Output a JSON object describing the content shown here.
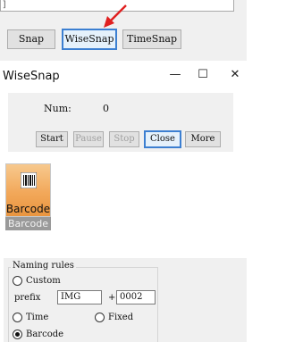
{
  "snap_toolbar": {
    "buttons": [
      "Snap",
      "WiseSnap",
      "TimeSnap"
    ],
    "field_text": "]"
  },
  "wisesnap_window": {
    "title": "WiseSnap",
    "controls": {
      "minimize": "—",
      "maximize": "☐",
      "close": "✕"
    },
    "num_label": "Num:",
    "num_value": "0",
    "buttons": {
      "start": "Start",
      "pause": "Pause",
      "stop": "Stop",
      "close": "Close",
      "more": "More"
    }
  },
  "barcode_tile": {
    "label": "Barcode",
    "caption": "Barcode"
  },
  "naming_rules": {
    "title": "Naming rules",
    "custom_label": "Custom",
    "prefix_label": "prefix",
    "prefix_value": "IMG",
    "plus": "+",
    "number_value": "0002",
    "time_label": "Time",
    "fixed_label": "Fixed",
    "barcode_label": "Barcode",
    "selected": "Barcode"
  },
  "colors": {
    "accent": "#3c7fd1",
    "arrow": "#e02020",
    "tile_orange": "#f2a85a"
  }
}
